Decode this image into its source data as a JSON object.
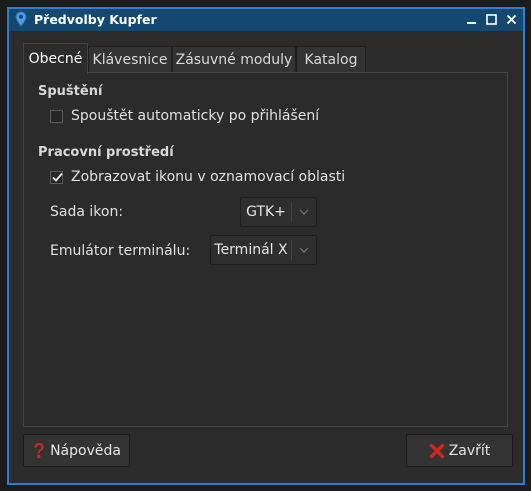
{
  "window": {
    "title": "Předvolby Kupfer",
    "icon": "map-pin-icon",
    "controls": {
      "minimize": "minimize-icon",
      "maximize": "maximize-icon",
      "close": "close-icon"
    }
  },
  "tabs": [
    {
      "label": "Obecné",
      "active": true
    },
    {
      "label": "Klávesnice",
      "active": false
    },
    {
      "label": "Zásuvné moduly",
      "active": false
    },
    {
      "label": "Katalog",
      "active": false
    }
  ],
  "general": {
    "startup": {
      "heading": "Spuštění",
      "autostart_label": "Spouštět automaticky po přihlášení",
      "autostart_checked": false
    },
    "desktop": {
      "heading": "Pracovní prostředí",
      "show_icon_label": "Zobrazovat ikonu v oznamovací oblasti",
      "show_icon_checked": true,
      "icon_set_label": "Sada ikon:",
      "icon_set_value": "GTK+",
      "terminal_label": "Emulátor terminálu:",
      "terminal_value": "Terminál X"
    }
  },
  "buttons": {
    "help": {
      "label": "Nápověda",
      "icon": "help-icon"
    },
    "close": {
      "label": "Zavřít",
      "icon": "close-icon"
    }
  },
  "colors": {
    "titlebar": "#15486f",
    "border": "#2a7fd4",
    "background": "#2b2b2b",
    "help_icon": "#d0271d",
    "close_icon": "#d0271d"
  }
}
